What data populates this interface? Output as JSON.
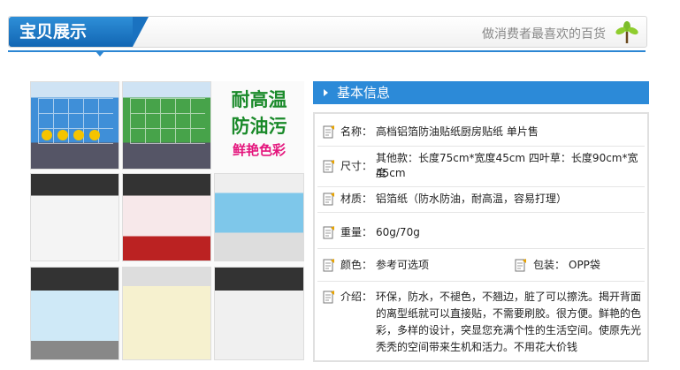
{
  "header": {
    "title": "宝贝展示",
    "slogan": "做消费者最喜欢的百货",
    "logo_icon": "tree-icon"
  },
  "promo": {
    "line1": "耐高温",
    "line2": "防油污",
    "line3": "鲜艳色彩"
  },
  "info": {
    "section_title": "基本信息",
    "rows": [
      {
        "label": "名称：",
        "value": "高档铝箔防油贴纸厨房贴纸 单片售"
      },
      {
        "label": "尺寸：",
        "value_line1": "其他款：长度75cm*宽度45cm 四叶草：长度90cm*宽度",
        "value_line2": "45cm"
      },
      {
        "label": "材质：",
        "value": "铝箔纸（防水防油，耐高温，容易打理）"
      },
      {
        "label": "重量：",
        "value": "60g/70g"
      },
      {
        "label": "颜色：",
        "value": "参考可选项",
        "label2": "包装：",
        "value2": "OPP袋"
      },
      {
        "label": "介绍：",
        "lines": [
          "环保，防水，不褪色，不翘边，脏了可以擦洗。揭开背面",
          "的离型纸就可以直接贴，不需要刷胶。很方便。鲜艳的色",
          "彩，多样的设计，突显您充满个性的生活空间。使原先光",
          "秃秃的空间带来生机和活力。不用花大价钱"
        ]
      }
    ]
  },
  "colors": {
    "accent_blue": "#2b86d3",
    "promo_green": "#1a8a2a",
    "promo_pink": "#e4147c"
  }
}
